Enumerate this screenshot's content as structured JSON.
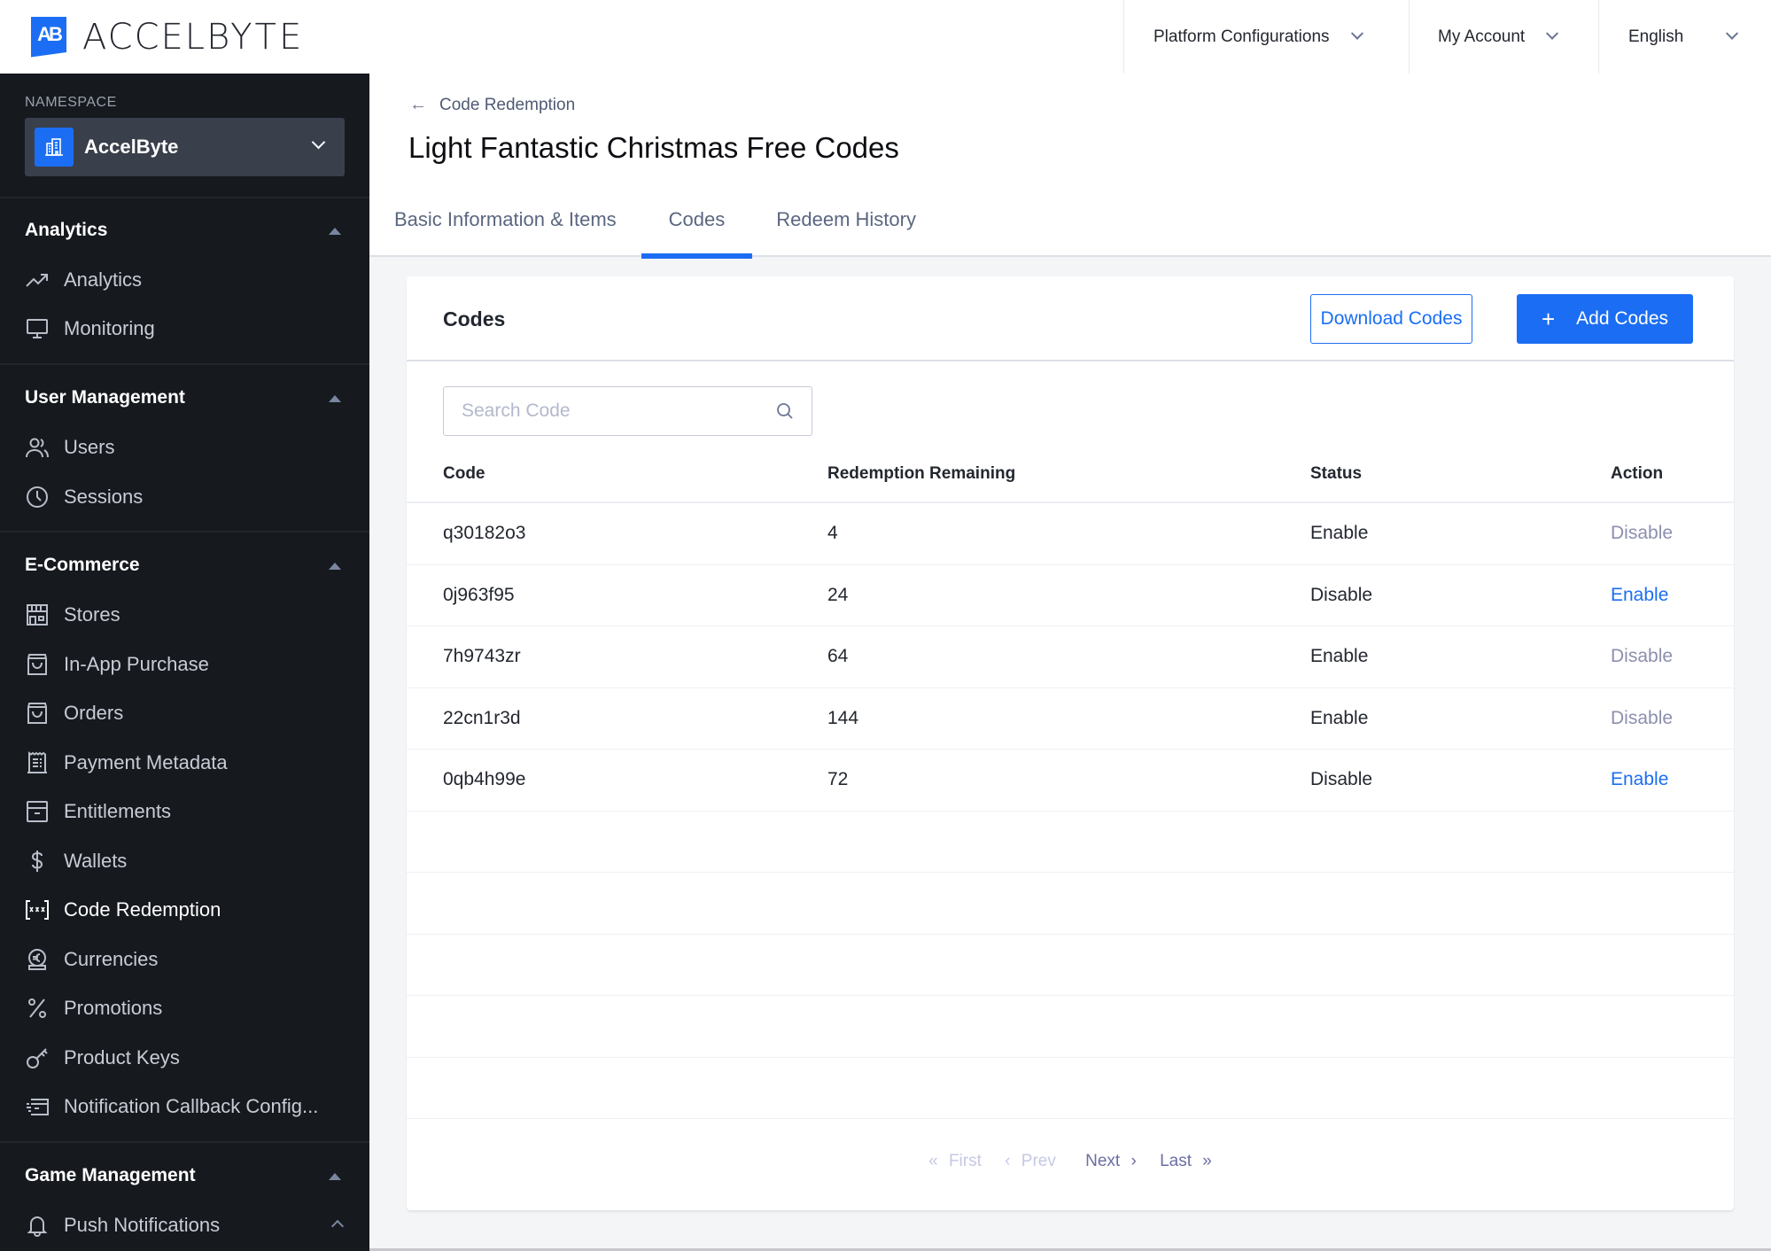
{
  "logo": {
    "mark": "AB",
    "text_a": "ACCEL",
    "text_b": "BYTE"
  },
  "top_menu": {
    "platform": "Platform Configurations",
    "account": "My Account",
    "language": "English"
  },
  "sidebar": {
    "namespace_label": "NAMESPACE",
    "namespace_value": "AccelByte",
    "sections": [
      {
        "title": "Analytics",
        "items": [
          {
            "label": "Analytics",
            "icon": "trend-up-icon"
          },
          {
            "label": "Monitoring",
            "icon": "monitor-icon"
          }
        ]
      },
      {
        "title": "User Management",
        "items": [
          {
            "label": "Users",
            "icon": "users-icon"
          },
          {
            "label": "Sessions",
            "icon": "clock-icon"
          }
        ]
      },
      {
        "title": "E-Commerce",
        "items": [
          {
            "label": "Stores",
            "icon": "store-icon"
          },
          {
            "label": "In-App Purchase",
            "icon": "bag-icon"
          },
          {
            "label": "Orders",
            "icon": "bag-icon"
          },
          {
            "label": "Payment Metadata",
            "icon": "receipt-icon"
          },
          {
            "label": "Entitlements",
            "icon": "archive-icon"
          },
          {
            "label": "Wallets",
            "icon": "dollar-icon"
          },
          {
            "label": "Code Redemption",
            "icon": "code-brackets-icon",
            "active": true
          },
          {
            "label": "Currencies",
            "icon": "euro-coin-icon"
          },
          {
            "label": "Promotions",
            "icon": "percent-icon"
          },
          {
            "label": "Product Keys",
            "icon": "key-icon"
          },
          {
            "label": "Notification Callback Config...",
            "icon": "callback-card-icon"
          }
        ]
      },
      {
        "title": "Game Management",
        "items": [
          {
            "label": "Push Notifications",
            "icon": "bell-icon"
          }
        ]
      }
    ]
  },
  "header": {
    "breadcrumb": "Code Redemption",
    "title": "Light Fantastic Christmas Free Codes",
    "tabs": [
      "Basic Information & Items",
      "Codes",
      "Redeem History"
    ],
    "active_tab": "Codes"
  },
  "card": {
    "title": "Codes",
    "download_label": "Download Codes",
    "add_label": "Add Codes",
    "search_placeholder": "Search Code",
    "columns": [
      "Code",
      "Redemption Remaining",
      "Status",
      "Action"
    ],
    "rows": [
      {
        "code": "q30182o3",
        "remaining": "4",
        "status": "Enable",
        "action": "Disable"
      },
      {
        "code": "0j963f95",
        "remaining": "24",
        "status": "Disable",
        "action": "Enable"
      },
      {
        "code": "7h9743zr",
        "remaining": "64",
        "status": "Enable",
        "action": "Disable"
      },
      {
        "code": "22cn1r3d",
        "remaining": "144",
        "status": "Enable",
        "action": "Disable"
      },
      {
        "code": "0qb4h99e",
        "remaining": "72",
        "status": "Disable",
        "action": "Enable"
      }
    ],
    "pager": {
      "first": "First",
      "prev": "Prev",
      "next": "Next",
      "last": "Last"
    }
  },
  "colors": {
    "accent": "#1b6ef3",
    "sidebar_bg": "#16191e",
    "disabled_action": "#8c8fae"
  }
}
